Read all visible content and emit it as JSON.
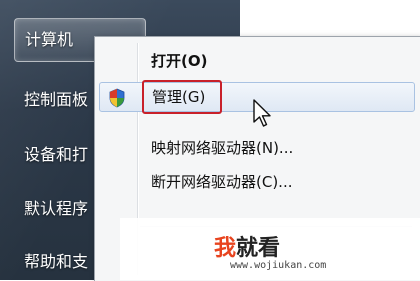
{
  "start_panel": {
    "items": [
      {
        "label": "计算机"
      },
      {
        "label": "控制面板"
      },
      {
        "label": "设备和打"
      },
      {
        "label": "默认程序"
      },
      {
        "label": "帮助和支"
      }
    ]
  },
  "context_menu": {
    "items": [
      {
        "label": "打开(O)"
      },
      {
        "label": "管理(G)"
      },
      {
        "label": "映射网络驱动器(N)..."
      },
      {
        "label": "断开网络驱动器(C)..."
      }
    ]
  },
  "watermark": {
    "logo_accent": "我",
    "logo_rest": "就看",
    "url": "www.wojiukan.com"
  },
  "colors": {
    "highlight_box": "#c8202a",
    "logo_accent": "#e8441f"
  }
}
